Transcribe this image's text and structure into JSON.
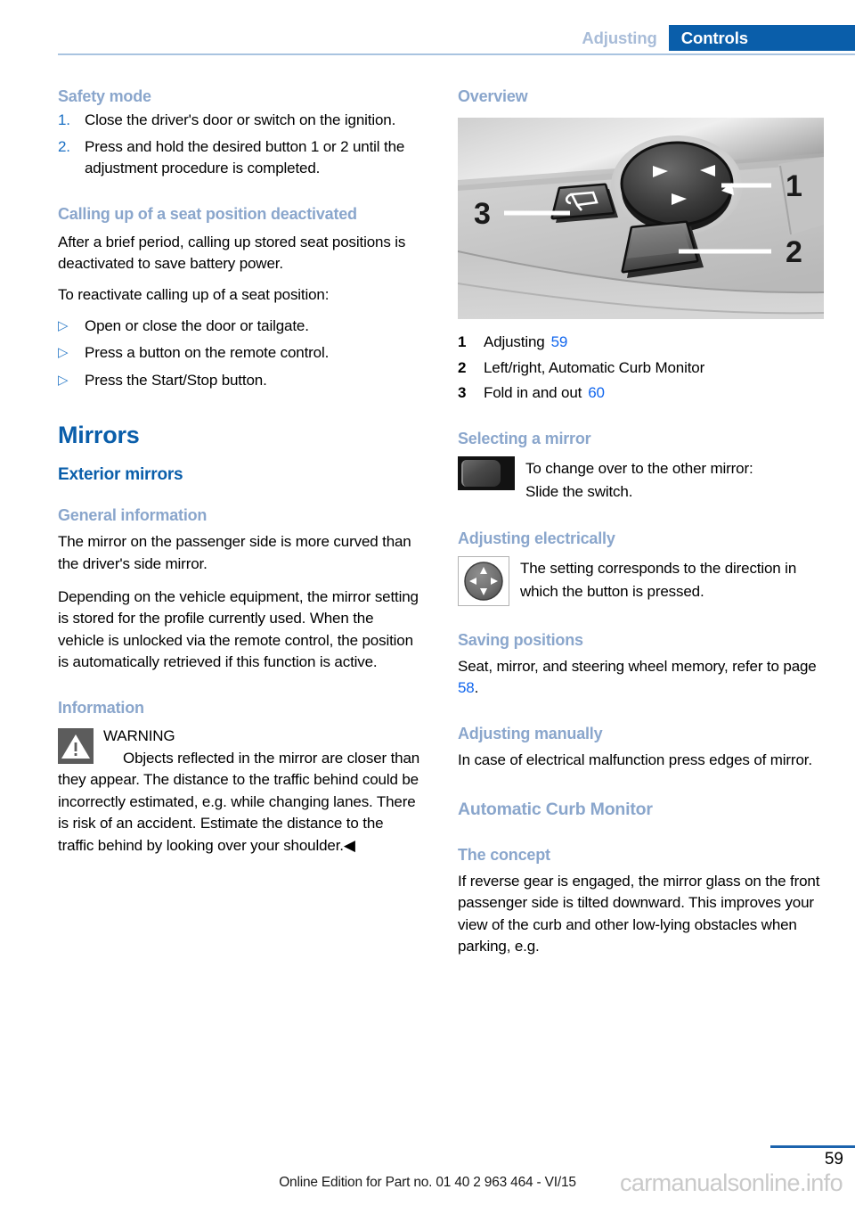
{
  "header": {
    "section_inactive": "Adjusting",
    "section_active": "Controls"
  },
  "left_column": {
    "safety_mode": {
      "heading": "Safety mode",
      "steps": [
        {
          "marker": "1.",
          "text": "Close the driver's door or switch on the ignition."
        },
        {
          "marker": "2.",
          "text": "Press and hold the desired button 1 or 2 until the adjustment procedure is completed."
        }
      ]
    },
    "calling_up": {
      "heading": "Calling up of a seat position deactivated",
      "para1": "After a brief period, calling up stored seat positions is deactivated to save battery power.",
      "para2": "To reactivate calling up of a seat position:",
      "bullets": [
        {
          "marker": "▷",
          "text": "Open or close the door or tailgate."
        },
        {
          "marker": "▷",
          "text": "Press a button on the remote control."
        },
        {
          "marker": "▷",
          "text": "Press the Start/Stop button."
        }
      ]
    },
    "mirrors": {
      "heading": "Mirrors",
      "subheading": "Exterior mirrors",
      "general_information": {
        "heading": "General information",
        "para1": "The mirror on the passenger side is more curved than the driver's side mirror.",
        "para2": "Depending on the vehicle equipment, the mirror setting is stored for the profile currently used. When the vehicle is unlocked via the remote control, the position is automatically retrieved if this function is active."
      },
      "information": {
        "heading": "Information",
        "warning_label": "WARNING",
        "warning_text": "Objects reflected in the mirror are closer than they appear. The distance to the traffic behind could be incorrectly estimated, e.g. while changing lanes. There is risk of an accident. Estimate the distance to the traffic behind by looking over your shoulder.",
        "end_mark": "◀"
      }
    }
  },
  "right_column": {
    "overview": {
      "heading": "Overview",
      "illustration_callouts": [
        "1",
        "2",
        "3"
      ],
      "legend": [
        {
          "num": "1",
          "label": "Adjusting",
          "pageref": "59"
        },
        {
          "num": "2",
          "label": "Left/right, Automatic Curb Monitor",
          "pageref": ""
        },
        {
          "num": "3",
          "label": "Fold in and out",
          "pageref": "60"
        }
      ]
    },
    "selecting_a_mirror": {
      "heading": "Selecting a mirror",
      "line1": "To change over to the other mirror:",
      "line2": "Slide the switch."
    },
    "adjusting_electrically": {
      "heading": "Adjusting electrically",
      "text": "The setting corresponds to the direction in which the button is pressed."
    },
    "saving_positions": {
      "heading": "Saving positions",
      "text_before": "Seat, mirror, and steering wheel memory, refer to page ",
      "pageref": "58",
      "text_after": "."
    },
    "adjusting_manually": {
      "heading": "Adjusting manually",
      "text": "In case of electrical malfunction press edges of mirror."
    },
    "automatic_curb_monitor": {
      "heading": "Automatic Curb Monitor",
      "the_concept": {
        "heading": "The concept",
        "text": "If reverse gear is engaged, the mirror glass on the front passenger side is tilted downward. This improves your view of the curb and other low-lying obstacles when parking, e.g."
      }
    }
  },
  "footer": {
    "edition_line": "Online Edition for Part no. 01 40 2 963 464 - VI/15",
    "page_number": "59",
    "watermark": "carmanualsonline.info"
  },
  "colors": {
    "accent_blue": "#0a5eaa",
    "light_blue": "#8aa6cc",
    "link_blue": "#1166ee",
    "rule_blue": "#a9c4e0"
  }
}
